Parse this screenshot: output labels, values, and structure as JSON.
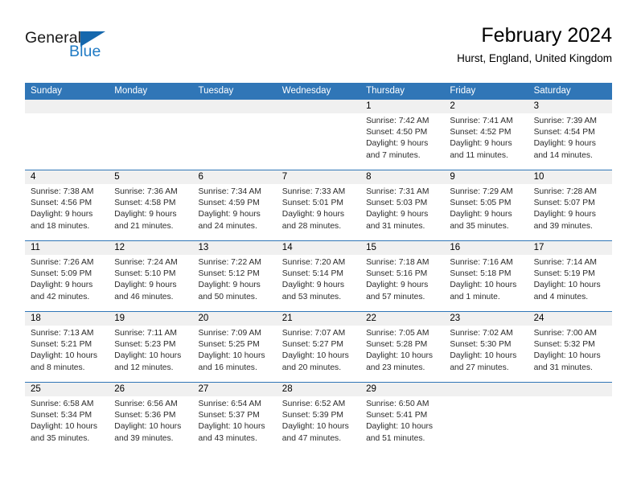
{
  "brand": {
    "name_primary": "General",
    "name_secondary": "Blue",
    "accent_color": "#1668ad",
    "text_color": "#1a1a1a"
  },
  "header": {
    "title": "February 2024",
    "subtitle": "Hurst, England, United Kingdom"
  },
  "theme": {
    "header_bg": "#3076b7",
    "header_text": "#ffffff",
    "numrow_bg": "#f0f0f0",
    "divider": "#3076b7"
  },
  "weekdays": [
    "Sunday",
    "Monday",
    "Tuesday",
    "Wednesday",
    "Thursday",
    "Friday",
    "Saturday"
  ],
  "labels": {
    "sunrise_prefix": "Sunrise:",
    "sunset_prefix": "Sunset:",
    "daylight_prefix": "Daylight:"
  },
  "weeks": [
    [
      {
        "day": "",
        "lines": []
      },
      {
        "day": "",
        "lines": []
      },
      {
        "day": "",
        "lines": []
      },
      {
        "day": "",
        "lines": []
      },
      {
        "day": "1",
        "lines": [
          "Sunrise: 7:42 AM",
          "Sunset: 4:50 PM",
          "Daylight: 9 hours",
          "and 7 minutes."
        ]
      },
      {
        "day": "2",
        "lines": [
          "Sunrise: 7:41 AM",
          "Sunset: 4:52 PM",
          "Daylight: 9 hours",
          "and 11 minutes."
        ]
      },
      {
        "day": "3",
        "lines": [
          "Sunrise: 7:39 AM",
          "Sunset: 4:54 PM",
          "Daylight: 9 hours",
          "and 14 minutes."
        ]
      }
    ],
    [
      {
        "day": "4",
        "lines": [
          "Sunrise: 7:38 AM",
          "Sunset: 4:56 PM",
          "Daylight: 9 hours",
          "and 18 minutes."
        ]
      },
      {
        "day": "5",
        "lines": [
          "Sunrise: 7:36 AM",
          "Sunset: 4:58 PM",
          "Daylight: 9 hours",
          "and 21 minutes."
        ]
      },
      {
        "day": "6",
        "lines": [
          "Sunrise: 7:34 AM",
          "Sunset: 4:59 PM",
          "Daylight: 9 hours",
          "and 24 minutes."
        ]
      },
      {
        "day": "7",
        "lines": [
          "Sunrise: 7:33 AM",
          "Sunset: 5:01 PM",
          "Daylight: 9 hours",
          "and 28 minutes."
        ]
      },
      {
        "day": "8",
        "lines": [
          "Sunrise: 7:31 AM",
          "Sunset: 5:03 PM",
          "Daylight: 9 hours",
          "and 31 minutes."
        ]
      },
      {
        "day": "9",
        "lines": [
          "Sunrise: 7:29 AM",
          "Sunset: 5:05 PM",
          "Daylight: 9 hours",
          "and 35 minutes."
        ]
      },
      {
        "day": "10",
        "lines": [
          "Sunrise: 7:28 AM",
          "Sunset: 5:07 PM",
          "Daylight: 9 hours",
          "and 39 minutes."
        ]
      }
    ],
    [
      {
        "day": "11",
        "lines": [
          "Sunrise: 7:26 AM",
          "Sunset: 5:09 PM",
          "Daylight: 9 hours",
          "and 42 minutes."
        ]
      },
      {
        "day": "12",
        "lines": [
          "Sunrise: 7:24 AM",
          "Sunset: 5:10 PM",
          "Daylight: 9 hours",
          "and 46 minutes."
        ]
      },
      {
        "day": "13",
        "lines": [
          "Sunrise: 7:22 AM",
          "Sunset: 5:12 PM",
          "Daylight: 9 hours",
          "and 50 minutes."
        ]
      },
      {
        "day": "14",
        "lines": [
          "Sunrise: 7:20 AM",
          "Sunset: 5:14 PM",
          "Daylight: 9 hours",
          "and 53 minutes."
        ]
      },
      {
        "day": "15",
        "lines": [
          "Sunrise: 7:18 AM",
          "Sunset: 5:16 PM",
          "Daylight: 9 hours",
          "and 57 minutes."
        ]
      },
      {
        "day": "16",
        "lines": [
          "Sunrise: 7:16 AM",
          "Sunset: 5:18 PM",
          "Daylight: 10 hours",
          "and 1 minute."
        ]
      },
      {
        "day": "17",
        "lines": [
          "Sunrise: 7:14 AM",
          "Sunset: 5:19 PM",
          "Daylight: 10 hours",
          "and 4 minutes."
        ]
      }
    ],
    [
      {
        "day": "18",
        "lines": [
          "Sunrise: 7:13 AM",
          "Sunset: 5:21 PM",
          "Daylight: 10 hours",
          "and 8 minutes."
        ]
      },
      {
        "day": "19",
        "lines": [
          "Sunrise: 7:11 AM",
          "Sunset: 5:23 PM",
          "Daylight: 10 hours",
          "and 12 minutes."
        ]
      },
      {
        "day": "20",
        "lines": [
          "Sunrise: 7:09 AM",
          "Sunset: 5:25 PM",
          "Daylight: 10 hours",
          "and 16 minutes."
        ]
      },
      {
        "day": "21",
        "lines": [
          "Sunrise: 7:07 AM",
          "Sunset: 5:27 PM",
          "Daylight: 10 hours",
          "and 20 minutes."
        ]
      },
      {
        "day": "22",
        "lines": [
          "Sunrise: 7:05 AM",
          "Sunset: 5:28 PM",
          "Daylight: 10 hours",
          "and 23 minutes."
        ]
      },
      {
        "day": "23",
        "lines": [
          "Sunrise: 7:02 AM",
          "Sunset: 5:30 PM",
          "Daylight: 10 hours",
          "and 27 minutes."
        ]
      },
      {
        "day": "24",
        "lines": [
          "Sunrise: 7:00 AM",
          "Sunset: 5:32 PM",
          "Daylight: 10 hours",
          "and 31 minutes."
        ]
      }
    ],
    [
      {
        "day": "25",
        "lines": [
          "Sunrise: 6:58 AM",
          "Sunset: 5:34 PM",
          "Daylight: 10 hours",
          "and 35 minutes."
        ]
      },
      {
        "day": "26",
        "lines": [
          "Sunrise: 6:56 AM",
          "Sunset: 5:36 PM",
          "Daylight: 10 hours",
          "and 39 minutes."
        ]
      },
      {
        "day": "27",
        "lines": [
          "Sunrise: 6:54 AM",
          "Sunset: 5:37 PM",
          "Daylight: 10 hours",
          "and 43 minutes."
        ]
      },
      {
        "day": "28",
        "lines": [
          "Sunrise: 6:52 AM",
          "Sunset: 5:39 PM",
          "Daylight: 10 hours",
          "and 47 minutes."
        ]
      },
      {
        "day": "29",
        "lines": [
          "Sunrise: 6:50 AM",
          "Sunset: 5:41 PM",
          "Daylight: 10 hours",
          "and 51 minutes."
        ]
      },
      {
        "day": "",
        "lines": []
      },
      {
        "day": "",
        "lines": []
      }
    ]
  ]
}
